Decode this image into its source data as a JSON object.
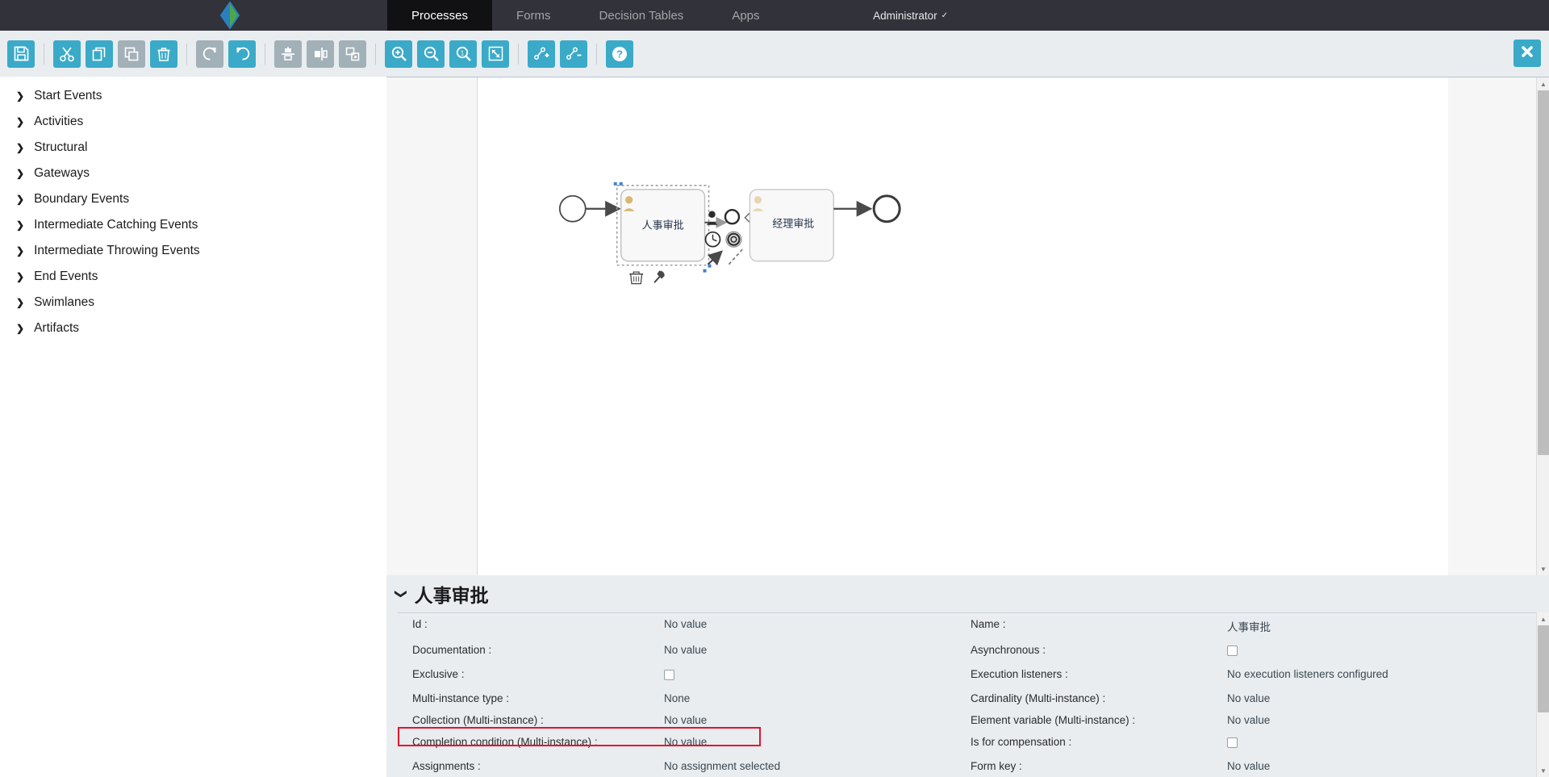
{
  "topnav": {
    "logo_icon": "diamond-logo-icon",
    "tabs": [
      {
        "label": "Processes",
        "active": true
      },
      {
        "label": "Forms",
        "active": false
      },
      {
        "label": "Decision Tables",
        "active": false
      },
      {
        "label": "Apps",
        "active": false
      }
    ],
    "user": "Administrator",
    "user_caret": "✓",
    "bg_color": "#32323a",
    "active_tab_color": "#111114"
  },
  "toolbar": {
    "accent_color": "#3aaac8",
    "disabled_color": "#a2b0b8",
    "bg_color": "#e9edf0",
    "buttons": [
      {
        "name": "save-button",
        "icon": "save-floppy-icon",
        "enabled": true
      },
      {
        "name": "cut-button",
        "icon": "scissors-icon",
        "enabled": true
      },
      {
        "name": "copy-button",
        "icon": "copy-icon",
        "enabled": true
      },
      {
        "name": "paste-button",
        "icon": "paste-icon",
        "enabled": false
      },
      {
        "name": "delete-button",
        "icon": "trash-icon",
        "enabled": true
      },
      {
        "name": "redo-button",
        "icon": "redo-arrow-icon",
        "enabled": false
      },
      {
        "name": "undo-button",
        "icon": "undo-arrow-icon",
        "enabled": true
      },
      {
        "name": "align-vertical-button",
        "icon": "align-vertical-icon",
        "enabled": false
      },
      {
        "name": "align-horizontal-button",
        "icon": "align-horizontal-icon",
        "enabled": false
      },
      {
        "name": "same-size-button",
        "icon": "same-size-icon",
        "enabled": false
      },
      {
        "name": "zoom-in-button",
        "icon": "zoom-in-icon",
        "enabled": true
      },
      {
        "name": "zoom-out-button",
        "icon": "zoom-out-icon",
        "enabled": true
      },
      {
        "name": "zoom-actual-button",
        "icon": "zoom-actual-size-icon",
        "enabled": true
      },
      {
        "name": "zoom-fit-button",
        "icon": "zoom-fit-icon",
        "enabled": true
      },
      {
        "name": "add-bendpoint-button",
        "icon": "add-bendpoint-icon",
        "enabled": true
      },
      {
        "name": "remove-bendpoint-button",
        "icon": "remove-bendpoint-icon",
        "enabled": true
      },
      {
        "name": "help-button",
        "icon": "help-question-icon",
        "enabled": true
      }
    ],
    "close_button": {
      "name": "close-editor-button",
      "icon": "close-x-icon"
    }
  },
  "palette": {
    "items": [
      {
        "label": "Start Events"
      },
      {
        "label": "Activities"
      },
      {
        "label": "Structural"
      },
      {
        "label": "Gateways"
      },
      {
        "label": "Boundary Events"
      },
      {
        "label": "Intermediate Catching Events"
      },
      {
        "label": "Intermediate Throwing Events"
      },
      {
        "label": "End Events"
      },
      {
        "label": "Swimlanes"
      },
      {
        "label": "Artifacts"
      }
    ],
    "chevron_icon": "chevron-right-icon",
    "toggle_expand_icon": "chevron-right-icon",
    "toggle_collapse_icon": "chevron-left-icon"
  },
  "canvas": {
    "diagram": {
      "type": "bpmn",
      "nodes": [
        {
          "name": "start-event",
          "kind": "start-event",
          "label": ""
        },
        {
          "name": "user-task-1",
          "kind": "user-task",
          "label": "人事审批",
          "selected": true
        },
        {
          "name": "user-task-2",
          "kind": "user-task",
          "label": "经理审批",
          "selected": false
        },
        {
          "name": "end-event",
          "kind": "end-event",
          "label": ""
        }
      ],
      "edges": [
        {
          "from": "start-event",
          "to": "user-task-1"
        },
        {
          "from": "user-task-1",
          "to": "user-task-2"
        },
        {
          "from": "user-task-2",
          "to": "end-event"
        }
      ],
      "quick_menu": [
        {
          "name": "quick-morph-user-task-icon",
          "icon": "user-task-icon"
        },
        {
          "name": "quick-morph-event-icon",
          "icon": "circle-icon"
        },
        {
          "name": "quick-morph-gateway-icon",
          "icon": "gateway-diamond-icon"
        },
        {
          "name": "quick-morph-timer-icon",
          "icon": "timer-event-icon"
        },
        {
          "name": "quick-morph-end-icon",
          "icon": "end-event-icon"
        },
        {
          "name": "quick-sequence-flow-icon",
          "icon": "arrow-up-right-icon"
        },
        {
          "name": "quick-association-icon",
          "icon": "dashed-line-icon"
        }
      ],
      "selection_actions": [
        {
          "name": "delete-element-icon",
          "icon": "trash-icon"
        },
        {
          "name": "edit-element-icon",
          "icon": "wrench-icon"
        }
      ]
    },
    "scrollbar": {
      "up_arrow": "▲",
      "down_arrow": "▼"
    }
  },
  "properties": {
    "title": "人事审批",
    "collapse_icon": "chevron-down-icon",
    "highlight_color": "#e8112d",
    "rows": [
      {
        "left": {
          "label": "Id :",
          "value": "No value",
          "type": "text"
        },
        "right": {
          "label": "Name :",
          "value": "人事审批",
          "type": "text"
        }
      },
      {
        "left": {
          "label": "Documentation :",
          "value": "No value",
          "type": "text"
        },
        "right": {
          "label": "Asynchronous :",
          "value": "",
          "type": "checkbox",
          "checked": false
        }
      },
      {
        "left": {
          "label": "Exclusive :",
          "value": "",
          "type": "checkbox",
          "checked": false
        },
        "right": {
          "label": "Execution listeners :",
          "value": "No execution listeners configured",
          "type": "text"
        }
      },
      {
        "left": {
          "label": "Multi-instance type :",
          "value": "None",
          "type": "text"
        },
        "right": {
          "label": "Cardinality (Multi-instance) :",
          "value": "No value",
          "type": "text"
        }
      },
      {
        "left": {
          "label": "Collection (Multi-instance) :",
          "value": "No value",
          "type": "text"
        },
        "right": {
          "label": "Element variable (Multi-instance) :",
          "value": "No value",
          "type": "text"
        }
      },
      {
        "left": {
          "label": "Completion condition (Multi-instance) :",
          "value": "No value",
          "type": "text"
        },
        "right": {
          "label": "Is for compensation :",
          "value": "",
          "type": "checkbox",
          "checked": false
        }
      },
      {
        "left": {
          "label": "Assignments :",
          "value": "No assignment selected",
          "type": "text",
          "highlighted": true
        },
        "right": {
          "label": "Form key :",
          "value": "No value",
          "type": "text"
        }
      }
    ],
    "scrollbar": {
      "up_arrow": "▲",
      "down_arrow": "▼"
    }
  }
}
